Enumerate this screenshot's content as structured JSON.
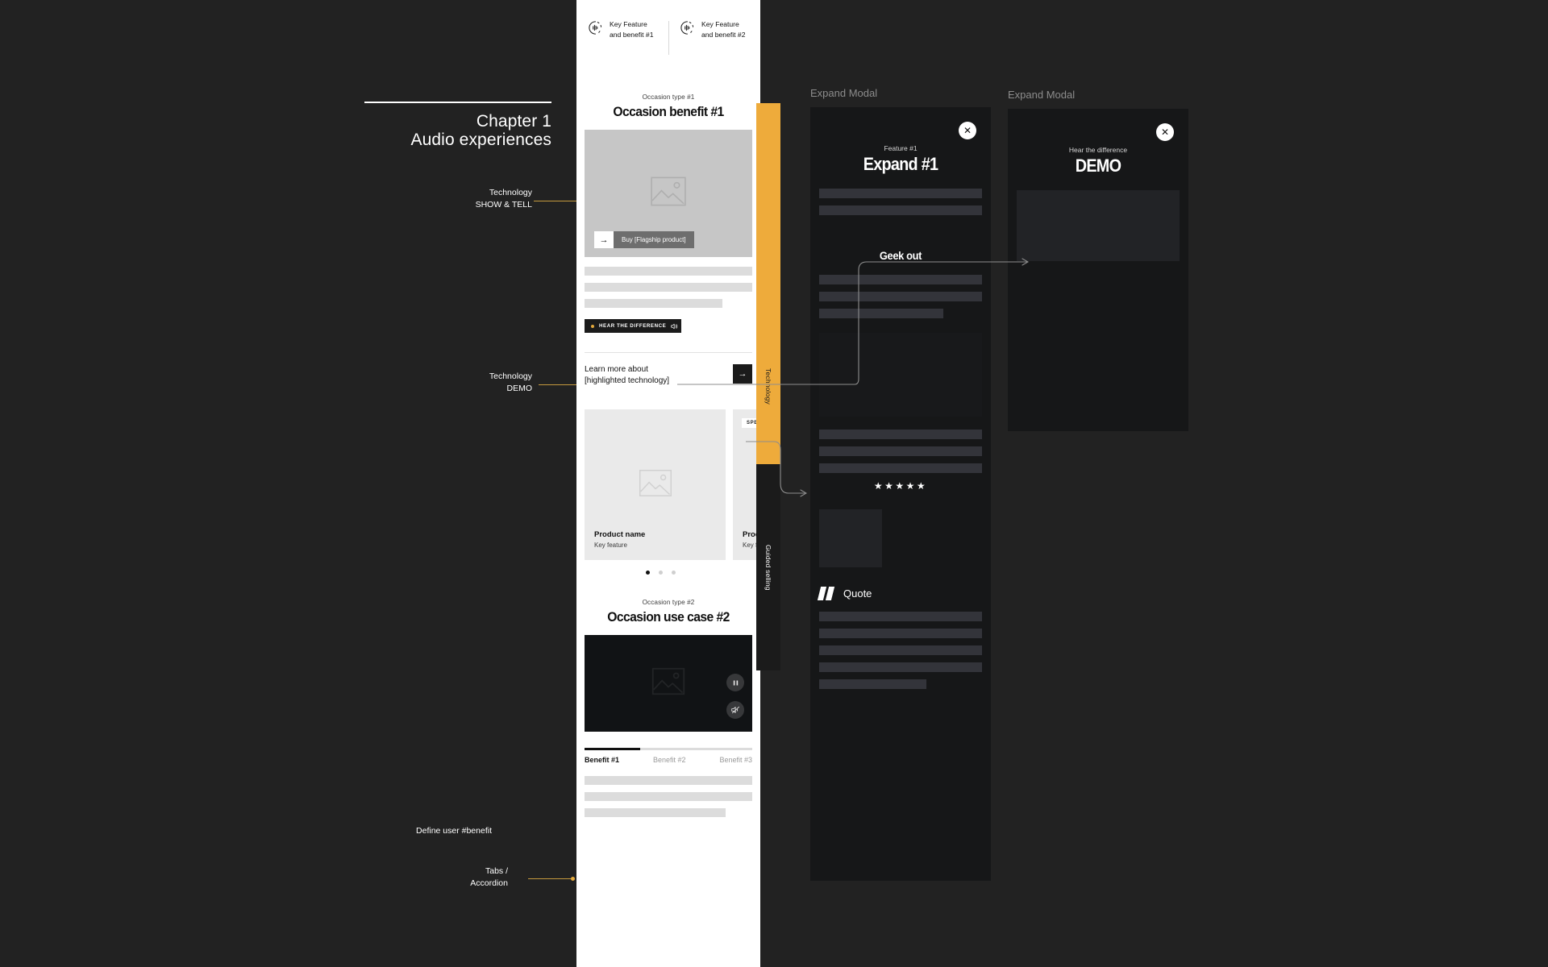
{
  "chapter": {
    "number": "Chapter 1",
    "title": "Audio experiences"
  },
  "annotations": [
    {
      "name": "show-and-tell",
      "line1": "Technology",
      "line2": "SHOW & TELL"
    },
    {
      "name": "technology-demo",
      "line1": "Technology",
      "line2": "DEMO"
    },
    {
      "name": "define-user-benefit",
      "line1": "Define user #benefit",
      "line2": ""
    },
    {
      "name": "tabs-accordion",
      "line1": "Tabs /",
      "line2": "Accordion"
    }
  ],
  "phone": {
    "key_features": [
      {
        "icon": "audio-wave-icon",
        "line1": "Key Feature",
        "line2": "and benefit #1"
      },
      {
        "icon": "audio-wave-icon",
        "line1": "Key Feature",
        "line2": "and benefit #2"
      }
    ],
    "occasion1": {
      "kicker": "Occasion type #1",
      "title": "Occasion benefit #1",
      "cta_arrow": "→",
      "cta_label": "Buy [Flagship product]",
      "body_lines": 3
    },
    "hear_pill": {
      "label": "HEAR THE DIFFERENCE",
      "icon": "speaker-icon"
    },
    "learn_more": {
      "line1": "Learn more about",
      "line2": "[highlighted technology]",
      "arrow": "→"
    },
    "carousel": {
      "cards": [
        {
          "badge": "",
          "name": "Product name",
          "feature": "Key feature"
        },
        {
          "badge": "SPECIAL",
          "name": "Product name",
          "feature": "Key feature"
        }
      ],
      "dots": 3,
      "active_dot": 0
    },
    "occasion2": {
      "kicker": "Occasion type #2",
      "title": "Occasion use case #2",
      "video_controls": [
        "pause-icon",
        "mute-icon"
      ]
    },
    "tabs": {
      "items": [
        "Benefit #1",
        "Benefit #2",
        "Benefit #3"
      ],
      "active_index": 0,
      "body_lines": 3
    }
  },
  "side_tabs": [
    {
      "label": "Technology",
      "color": "#eeab3b"
    },
    {
      "label": "Guided selling",
      "color": "#1b1b1b"
    }
  ],
  "modals": [
    {
      "label": "Expand Modal",
      "close_icon": "close-icon",
      "kicker": "Feature #1",
      "title": "Expand #1",
      "geek_out": "Geek out",
      "stars": "★★★★★",
      "quote_label": "Quote",
      "quote_icon": "quote-mark-icon"
    },
    {
      "label": "Expand Modal",
      "close_icon": "close-icon",
      "kicker": "Hear the difference",
      "title": "DEMO"
    }
  ],
  "colors": {
    "background": "#222222",
    "accent": "#eeab3b",
    "leader": "#c69a3e",
    "panel": "#161718",
    "white": "#ffffff"
  }
}
